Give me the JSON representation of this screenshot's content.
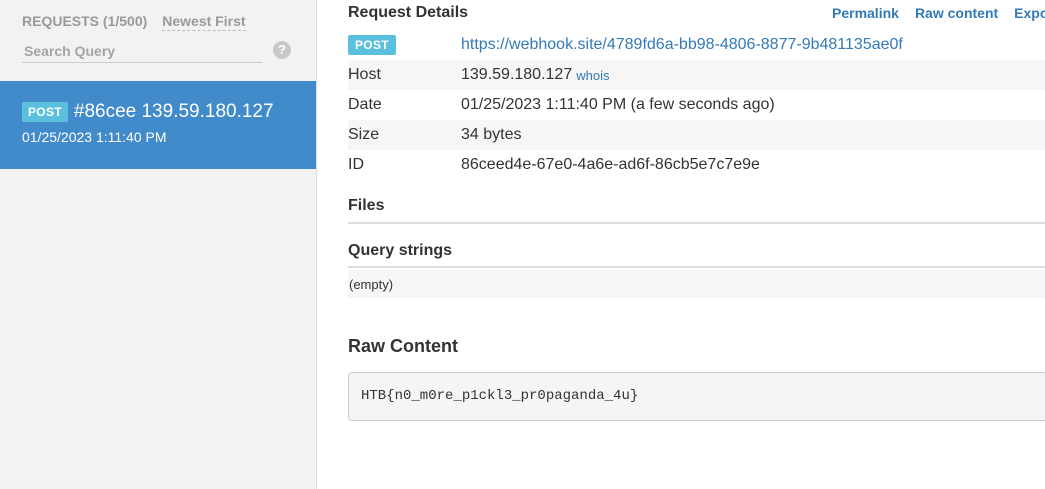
{
  "sidebar": {
    "count_label": "REQUESTS (1/500)",
    "sort_label": "Newest First",
    "search_placeholder": "Search Query",
    "help_glyph": "?",
    "selected_request": {
      "method": "POST",
      "title": "#86cee 139.59.180.127",
      "date": "01/25/2023 1:11:40 PM"
    }
  },
  "main": {
    "title": "Request Details",
    "links": {
      "permalink": "Permalink",
      "raw": "Raw content",
      "export": "Export as"
    },
    "details": {
      "method": "POST",
      "url": "https://webhook.site/4789fd6a-bb98-4806-8877-9b481135ae0f",
      "host_label": "Host",
      "host_value": "139.59.180.127",
      "whois": "whois",
      "date_label": "Date",
      "date_value": "01/25/2023 1:11:40 PM (a few seconds ago)",
      "size_label": "Size",
      "size_value": "34 bytes",
      "id_label": "ID",
      "id_value": "86ceed4e-67e0-4a6e-ad6f-86cb5e7c7e9e"
    },
    "files_title": "Files",
    "query_title": "Query strings",
    "query_empty": "(empty)",
    "raw_title": "Raw Content",
    "raw_body": "HTB{n0_m0re_p1ckl3_pr0paganda_4u}"
  },
  "colors": {
    "accent": "#428bca",
    "badge": "#5bc0de",
    "link": "#337ab7"
  }
}
